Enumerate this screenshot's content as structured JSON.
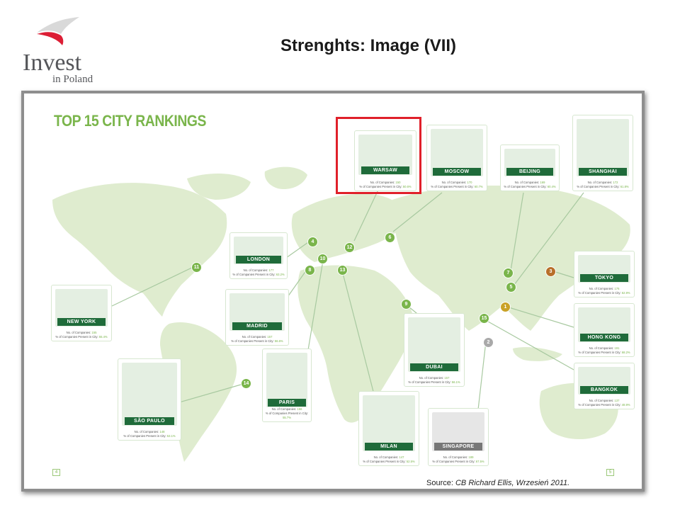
{
  "header": {
    "title": "Strenghts: Image (VII)",
    "logo_text": "Invest",
    "logo_subtext": "in Poland"
  },
  "slide": {
    "heading": "TOP 15 CITY RANKINGS",
    "page_left": "4",
    "page_right": "5",
    "source_label": "Source:",
    "source_text": "CB Richard Ellis, Wrzesień 2011."
  },
  "stats_labels": {
    "companies": "No. of Companies:",
    "percent": "% of Companies Present in City:"
  },
  "cities": [
    {
      "name": "WARSAW",
      "companies": "150",
      "percent": "50.6%",
      "highlighted": true
    },
    {
      "name": "MOSCOW",
      "companies": "170",
      "percent": "60.7%"
    },
    {
      "name": "BEIJING",
      "companies": "169",
      "percent": "60.4%"
    },
    {
      "name": "SHANGHAI",
      "companies": "172",
      "percent": "61.8%"
    },
    {
      "name": "LONDON",
      "companies": "177",
      "percent": "63.2%"
    },
    {
      "name": "NEW YORK",
      "companies": "155",
      "percent": "55.4%"
    },
    {
      "name": "MADRID",
      "companies": "157",
      "percent": "56.6%"
    },
    {
      "name": "TOKYO",
      "companies": "176",
      "percent": "62.9%"
    },
    {
      "name": "DUBAI",
      "companies": "157",
      "percent": "56.1%"
    },
    {
      "name": "HONG KONG",
      "companies": "191",
      "percent": "68.2%"
    },
    {
      "name": "SÃO PAULO",
      "companies": "148",
      "percent": "53.1%"
    },
    {
      "name": "PARIS",
      "companies": "156",
      "percent": "55.7%"
    },
    {
      "name": "BANGKOK",
      "companies": "137",
      "percent": "48.9%"
    },
    {
      "name": "MILAN",
      "companies": "147",
      "percent": "52.5%"
    },
    {
      "name": "SINGAPORE",
      "companies": "189",
      "percent": "67.5%"
    }
  ],
  "ranks": [
    "1",
    "2",
    "3",
    "4",
    "5",
    "6",
    "7",
    "8",
    "9",
    "10",
    "11",
    "12",
    "13",
    "14",
    "15"
  ],
  "colors": {
    "accent_green": "#7ab54b",
    "dark_green": "#1f6b3a",
    "map_land": "#dfeccf",
    "highlight_red": "#e0202a",
    "gold": "#c9a227",
    "silver": "#a9a9a9",
    "bronze": "#b86f2a"
  }
}
